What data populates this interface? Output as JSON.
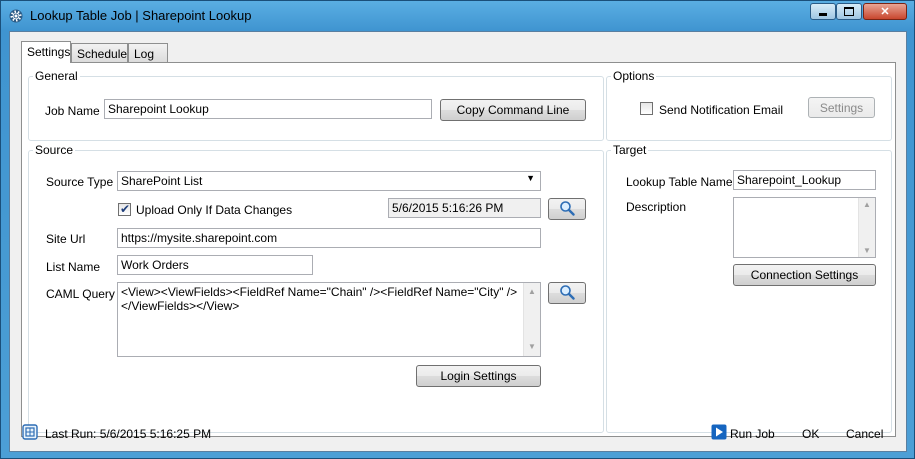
{
  "window": {
    "title": "Lookup Table Job | Sharepoint Lookup",
    "minimize_glyph": "—",
    "maximize_glyph": "□",
    "close_glyph": "✕"
  },
  "tabs": [
    {
      "label": "Settings",
      "active": true
    },
    {
      "label": "Schedule",
      "active": false
    },
    {
      "label": "Log",
      "active": false
    }
  ],
  "general": {
    "legend": "General",
    "job_name_label": "Job Name",
    "job_name_value": "Sharepoint Lookup",
    "copy_command_line": "Copy Command Line"
  },
  "options": {
    "legend": "Options",
    "send_notification_label": "Send Notification Email",
    "send_notification_checked": false,
    "settings_button": "Settings"
  },
  "source": {
    "legend": "Source",
    "source_type_label": "Source Type",
    "source_type_value": "SharePoint List",
    "upload_only_label": "Upload Only If Data Changes",
    "upload_only_checked": true,
    "last_change": "5/6/2015 5:16:26 PM",
    "site_url_label": "Site Url",
    "site_url_value": "https://mysite.sharepoint.com",
    "list_name_label": "List Name",
    "list_name_value": "Work Orders",
    "caml_query_label": "CAML Query",
    "caml_query_value": "<View><ViewFields><FieldRef Name=\"Chain\" /><FieldRef Name=\"City\" /></ViewFields></View>",
    "login_settings": "Login Settings"
  },
  "target": {
    "legend": "Target",
    "lookup_table_name_label": "Lookup Table Name",
    "lookup_table_name_value": "Sharepoint_Lookup",
    "description_label": "Description",
    "description_value": "",
    "connection_settings": "Connection Settings"
  },
  "status": {
    "last_run": "Last Run: 5/6/2015 5:16:25 PM",
    "run_job": "Run Job",
    "ok": "OK",
    "cancel": "Cancel"
  },
  "colors": {
    "title_bar": "#4c9fd6",
    "run_job_icon": "#1565c0"
  }
}
